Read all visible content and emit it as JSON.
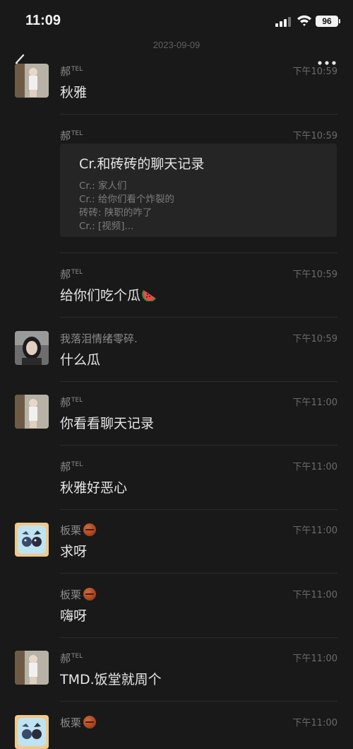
{
  "status": {
    "time": "11:09",
    "battery": "96"
  },
  "date_divider": "2023-09-09",
  "messages": [
    {
      "sender": "郝",
      "sender_sup": "TEL",
      "time": "下午10:59",
      "text": "秋雅"
    },
    {
      "sender": "郝",
      "sender_sup": "TEL",
      "time": "下午10:59",
      "record": {
        "title": "Cr.和砖砖的聊天记录",
        "lines": [
          "Cr.: 家人们",
          "Cr.: 给你们看个炸裂的",
          "砖砖: 陕职的咋了",
          "Cr.: [视频]..."
        ]
      }
    },
    {
      "sender": "郝",
      "sender_sup": "TEL",
      "time": "下午10:59",
      "text": "给你们吃个瓜"
    },
    {
      "sender": "我落泪情绪零碎.",
      "time": "下午10:59",
      "text": "什么瓜"
    },
    {
      "sender": "郝",
      "sender_sup": "TEL",
      "time": "下午11:00",
      "text": "你看看聊天记录"
    },
    {
      "sender": "郝",
      "sender_sup": "TEL",
      "time": "下午11:00",
      "text": "秋雅好恶心"
    },
    {
      "sender": "板栗",
      "time": "下午11:00",
      "text": "求呀"
    },
    {
      "sender": "板栗",
      "time": "下午11:00",
      "text": "嗨呀"
    },
    {
      "sender": "郝",
      "sender_sup": "TEL",
      "time": "下午11:00",
      "text": "TMD.饭堂就周个"
    },
    {
      "sender": "板栗",
      "time": "下午11:00",
      "text": ""
    }
  ],
  "icons": {
    "back": "chevron-left-icon",
    "more": "more-dots-icon",
    "watermelon": "watermelon-icon",
    "chestnut": "chestnut-icon"
  }
}
